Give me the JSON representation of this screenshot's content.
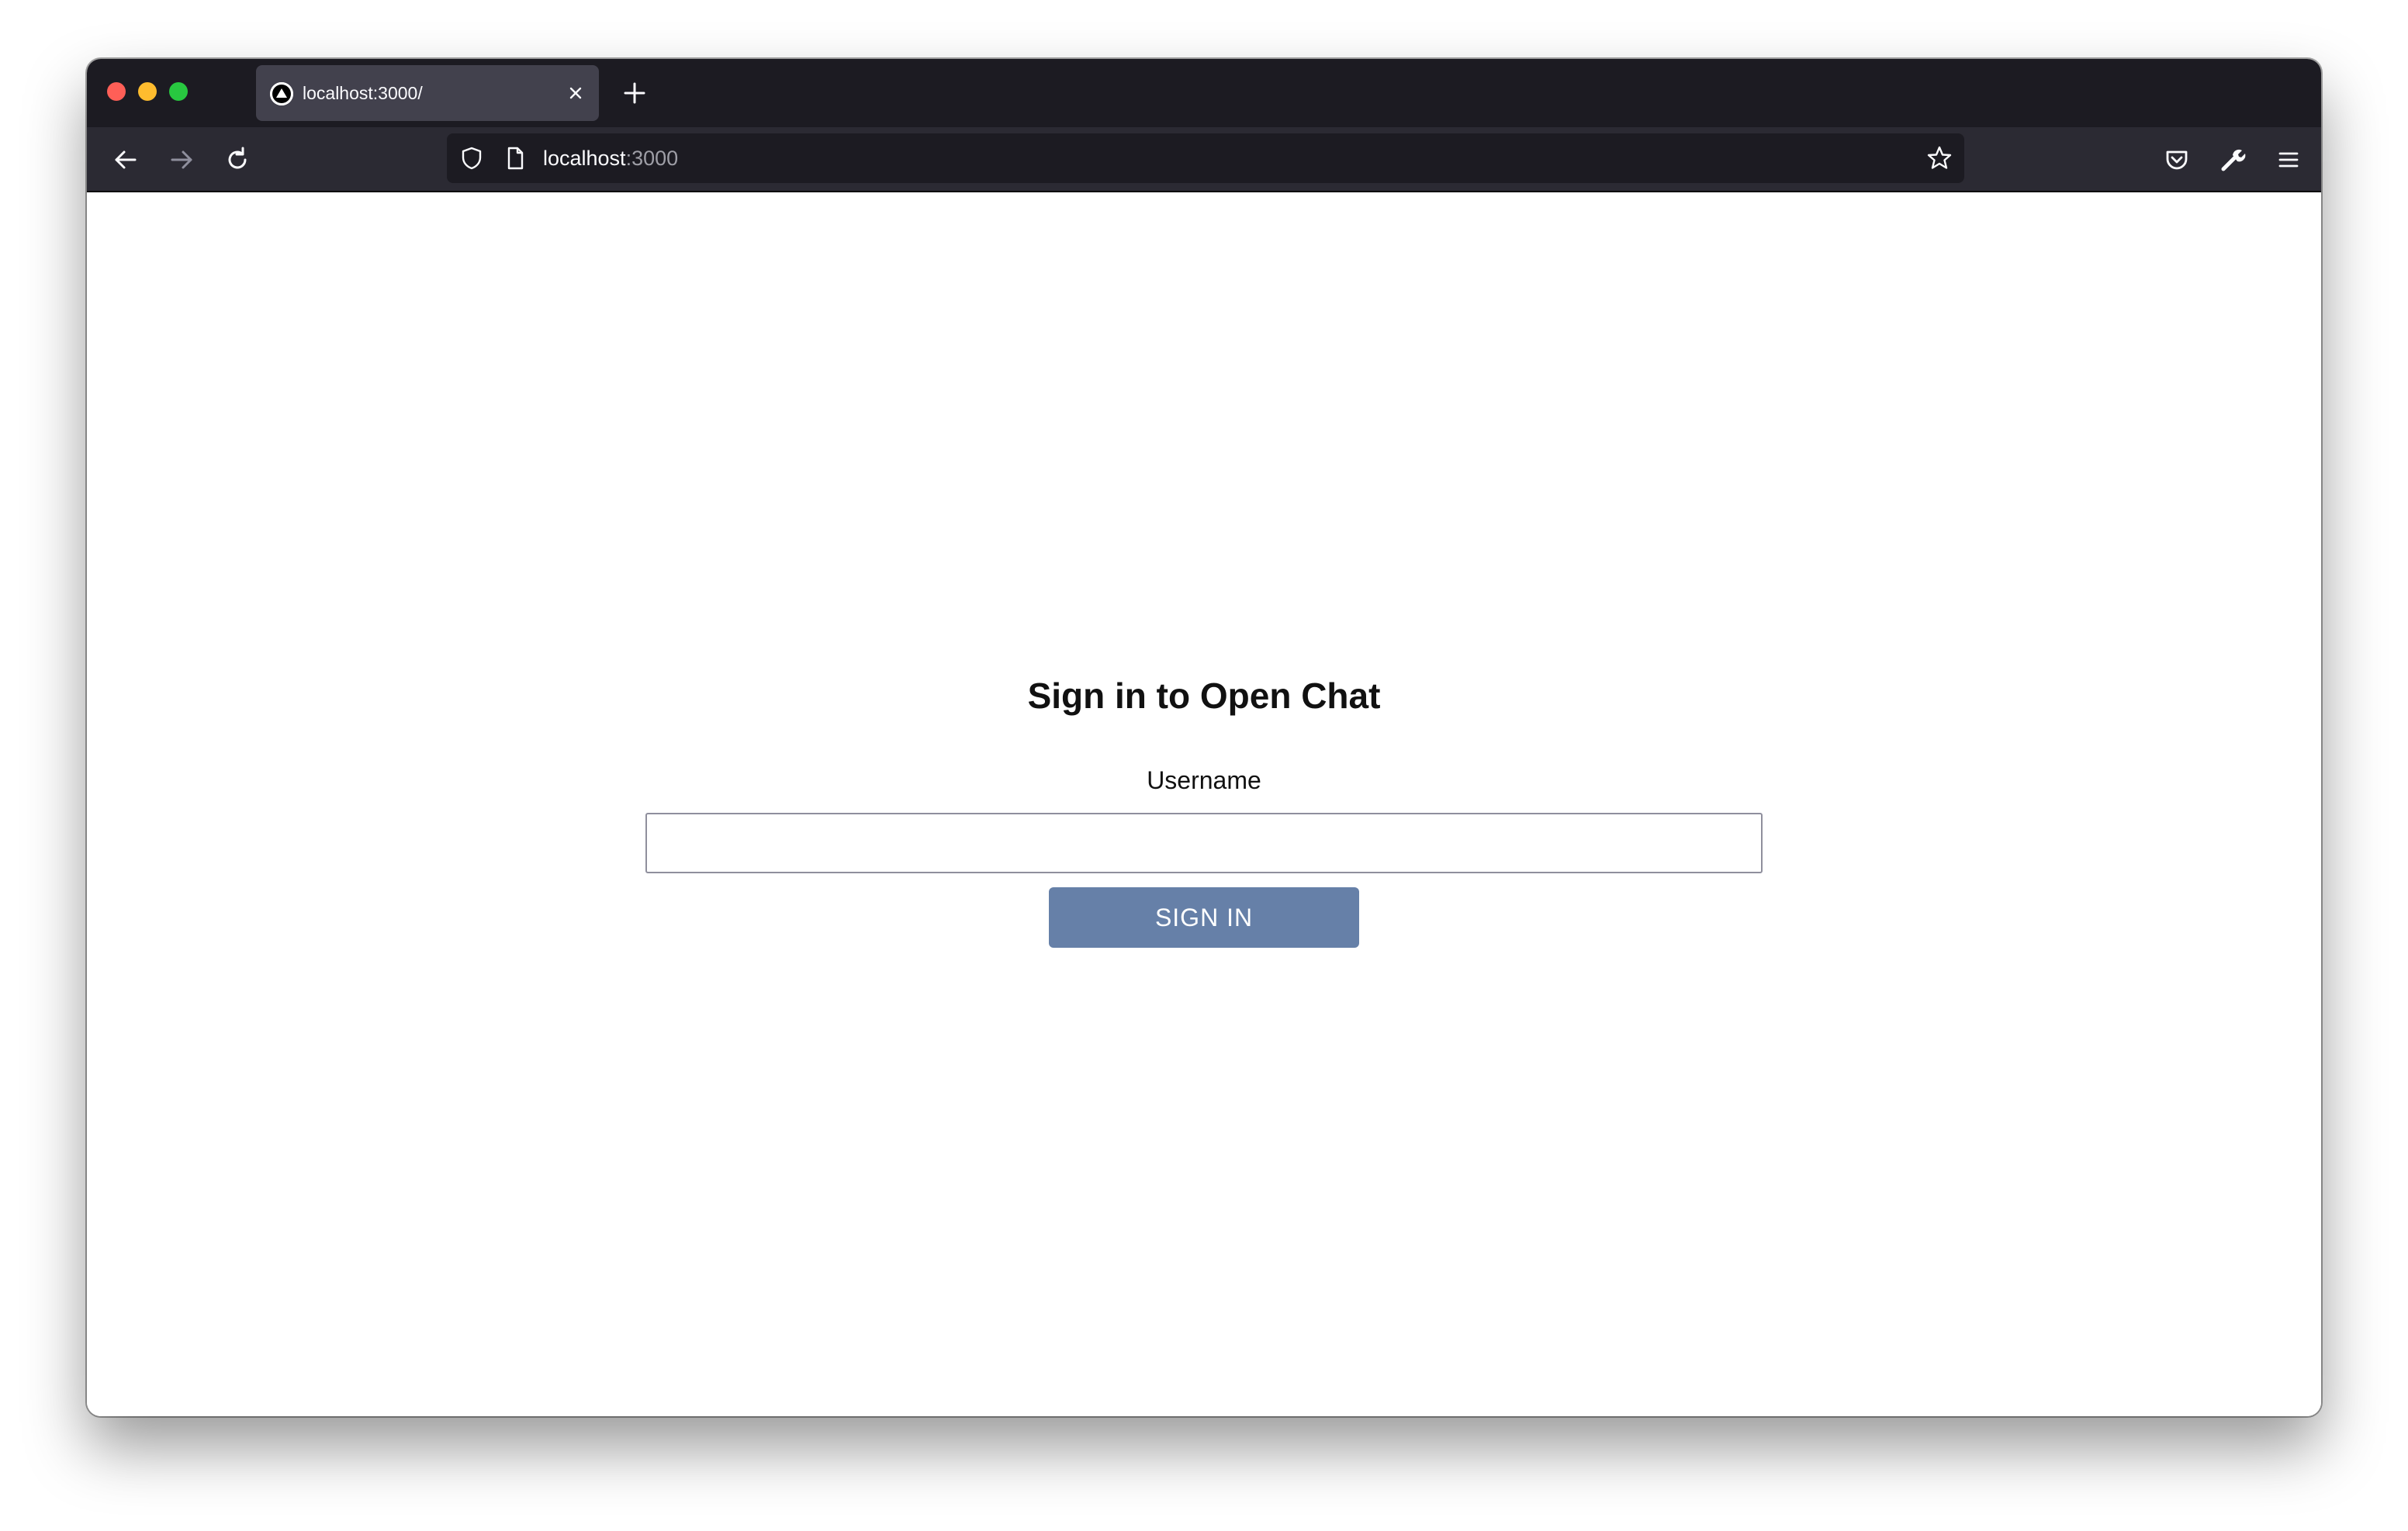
{
  "browser": {
    "tab": {
      "title": "localhost:3000/",
      "favicon": "triangle-logo-icon"
    },
    "url": {
      "host": "localhost",
      "port": ":3000"
    },
    "icons": {
      "back": "arrow-left-icon",
      "forward": "arrow-right-icon",
      "reload": "reload-icon",
      "shield": "shield-icon",
      "page": "page-icon",
      "bookmark": "star-icon",
      "pocket": "pocket-icon",
      "devtools": "wrench-icon",
      "menu": "hamburger-menu-icon"
    },
    "colors": {
      "tabstrip": "#1c1b22",
      "navbar": "#2b2a33",
      "active_tab": "#42414d"
    }
  },
  "page": {
    "heading": "Sign in to Open Chat",
    "username_label": "Username",
    "username_value": "",
    "signin_label": "SIGN IN",
    "colors": {
      "button": "#6680a8",
      "button_text": "#ffffff"
    }
  }
}
